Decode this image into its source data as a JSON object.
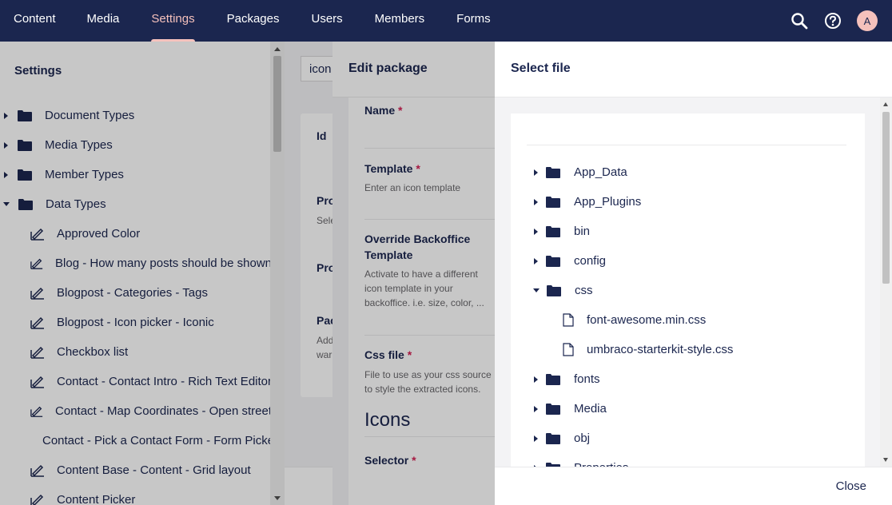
{
  "topbar": {
    "nav": [
      "Content",
      "Media",
      "Settings",
      "Packages",
      "Users",
      "Members",
      "Forms"
    ],
    "active_nav": "Settings",
    "avatar_initial": "A",
    "accent_color": "#f5c1bc",
    "bar_color": "#1b264f"
  },
  "tree": {
    "title": "Settings",
    "folders": [
      {
        "label": "Document Types",
        "expanded": false
      },
      {
        "label": "Media Types",
        "expanded": false
      },
      {
        "label": "Member Types",
        "expanded": false
      },
      {
        "label": "Data Types",
        "expanded": true
      }
    ],
    "items": [
      "Approved Color",
      "Blog - How many posts should be shown",
      "Blogpost - Categories - Tags",
      "Blogpost - Icon picker - Iconic",
      "Checkbox list",
      "Contact - Contact Intro - Rich Text Editor",
      "Contact - Map Coordinates - Open street",
      "Contact - Pick a Contact Form - Form Picker",
      "Content Base - Content - Grid layout",
      "Content Picker"
    ]
  },
  "content": {
    "search_value": "icon",
    "card_labels": [
      "Id",
      "Pro",
      "Pro",
      "Pac"
    ],
    "card_descs": [
      "Sele",
      "Add",
      "war"
    ]
  },
  "edit_package": {
    "title": "Edit package",
    "name_label": "Name",
    "template_label": "Template",
    "template_desc": "Enter an icon template",
    "override_label": "Override Backoffice Template",
    "override_desc": "Activate to have a different icon template in your backoffice. i.e. size, color, ...",
    "css_label": "Css file",
    "css_desc": "File to use as your css source to style the extracted icons.",
    "icons_heading": "Icons",
    "selector_label": "Selector",
    "required_mark": "*"
  },
  "select_file": {
    "title": "Select file",
    "items": [
      {
        "label": "App_Data",
        "type": "folder",
        "expanded": false,
        "depth": 0
      },
      {
        "label": "App_Plugins",
        "type": "folder",
        "expanded": false,
        "depth": 0
      },
      {
        "label": "bin",
        "type": "folder",
        "expanded": false,
        "depth": 0
      },
      {
        "label": "config",
        "type": "folder",
        "expanded": false,
        "depth": 0
      },
      {
        "label": "css",
        "type": "folder",
        "expanded": true,
        "depth": 0
      },
      {
        "label": "font-awesome.min.css",
        "type": "file",
        "depth": 1
      },
      {
        "label": "umbraco-starterkit-style.css",
        "type": "file",
        "depth": 1
      },
      {
        "label": "fonts",
        "type": "folder",
        "expanded": false,
        "depth": 0
      },
      {
        "label": "Media",
        "type": "folder",
        "expanded": false,
        "depth": 0
      },
      {
        "label": "obj",
        "type": "folder",
        "expanded": false,
        "depth": 0
      },
      {
        "label": "Properties",
        "type": "folder",
        "expanded": false,
        "depth": 0
      }
    ],
    "close_label": "Close"
  }
}
